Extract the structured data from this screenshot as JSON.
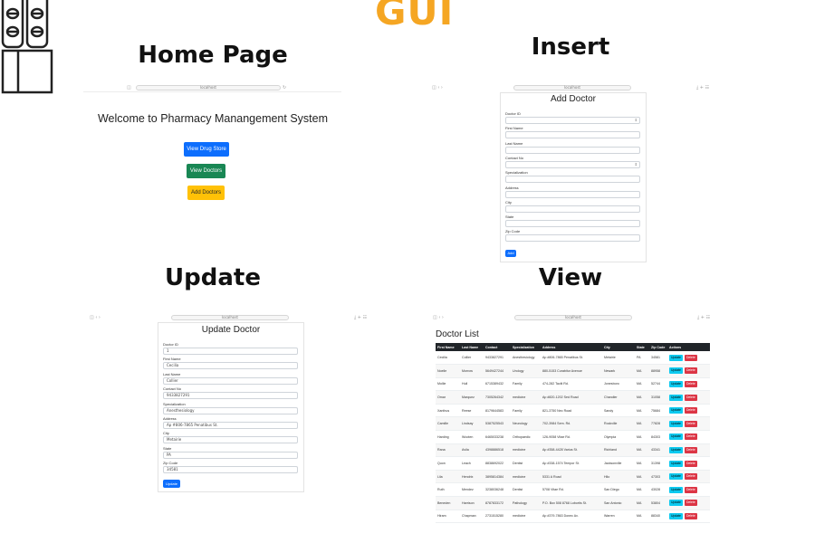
{
  "header": {
    "title": "GUI",
    "logo_icon": "pill-bottles-icon"
  },
  "sections": {
    "home": "Home Page",
    "insert": "Insert",
    "update": "Update",
    "view": "View"
  },
  "browser": {
    "url": "localhost"
  },
  "home": {
    "welcome": "Welcome to Pharmacy Manangement System",
    "buttons": {
      "drug_store": "View Drug Store",
      "view_doctors": "View Doctors",
      "add_doctors": "Add Doctors"
    }
  },
  "insert": {
    "title": "Add Doctor",
    "labels": [
      "Doctor ID",
      "First Name",
      "Last Name",
      "Contact No",
      "Specialization",
      "Address",
      "City",
      "State",
      "Zip Code"
    ],
    "submit": "Add"
  },
  "update": {
    "title": "Update Doctor",
    "fields": [
      {
        "label": "Doctor ID",
        "value": "1"
      },
      {
        "label": "First Name",
        "value": "Cecilia"
      },
      {
        "label": "Last Name",
        "value": "Collier"
      },
      {
        "label": "Contact No",
        "value": "9433827291"
      },
      {
        "label": "Specialization",
        "value": "Anesthesiology"
      },
      {
        "label": "Address",
        "value": "Ap #806-7865 Penatibus St."
      },
      {
        "label": "City",
        "value": "Metairie"
      },
      {
        "label": "State",
        "value": "PA"
      },
      {
        "label": "Zip Code",
        "value": "34581"
      }
    ],
    "submit": "Update"
  },
  "view": {
    "title": "Doctor List",
    "columns": [
      "First Name",
      "Last Name",
      "Contact",
      "Specialization",
      "Address",
      "City",
      "State",
      "Zip Code",
      "Actions"
    ],
    "rows": [
      [
        "Cecilia",
        "Collier",
        "9433827291",
        "Anesthesiology",
        "Ap #806-7865 Penatibus St.",
        "Metairie",
        "PA",
        "34581"
      ],
      [
        "Noelle",
        "Morrow",
        "5649427244",
        "Urology",
        "880-5153 Curabitur Avenue",
        "Newark",
        "MA",
        "88958"
      ],
      [
        "Mollie",
        "Hull",
        "6715389432",
        "Family",
        "474-282 Taciti Rd.",
        "Jonesboro",
        "MA",
        "52744"
      ],
      [
        "Omar",
        "Marquez",
        "7305264342",
        "medicine",
        "Ap #820-1202 Sed Road",
        "Chandler",
        "MA",
        "31058"
      ],
      [
        "Xanthus",
        "Reese",
        "8179644583",
        "Family",
        "821-3750 Nec Road",
        "Sandy",
        "MA",
        "75684"
      ],
      [
        "Camille",
        "Lindsay",
        "5387525543",
        "Neurology",
        "702-3984 Sem. Rd.",
        "Rockville",
        "MA",
        "77828"
      ],
      [
        "Harding",
        "Wooten",
        "6465033238",
        "Orthopaedic",
        "126-9058 Vitae Rd.",
        "Olympia",
        "MA",
        "84303"
      ],
      [
        "Rana",
        "Avila",
        "4398886518",
        "medicine",
        "Ap #358-4428 Varius St.",
        "Richland",
        "MA",
        "43341"
      ],
      [
        "Quon",
        "Leach",
        "8838692022",
        "Dentist",
        "Ap #338-1574 Tempor St.",
        "Jacksonville",
        "MA",
        "31398"
      ],
      [
        "Lila",
        "Hendrix",
        "3895814384",
        "medicine",
        "5331 A Road",
        "Hilo",
        "MA",
        "47303"
      ],
      [
        "Ruth",
        "Mendez",
        "3238036248",
        "Dentist",
        "5708 Vitae Rd.",
        "San Diego",
        "MA",
        "43028"
      ],
      [
        "Beneden",
        "Harrison",
        "8787833172",
        "Pathology",
        "P.O. Box 508 8768 Lobortis St.",
        "San Antonio",
        "MA",
        "53804"
      ],
      [
        "Hiram",
        "Chapman",
        "2731515280",
        "medicine",
        "Ap #379-7863 Donec Av.",
        "Warren",
        "MA",
        "88340"
      ]
    ],
    "action_update": "Update",
    "action_delete": "Delete"
  }
}
